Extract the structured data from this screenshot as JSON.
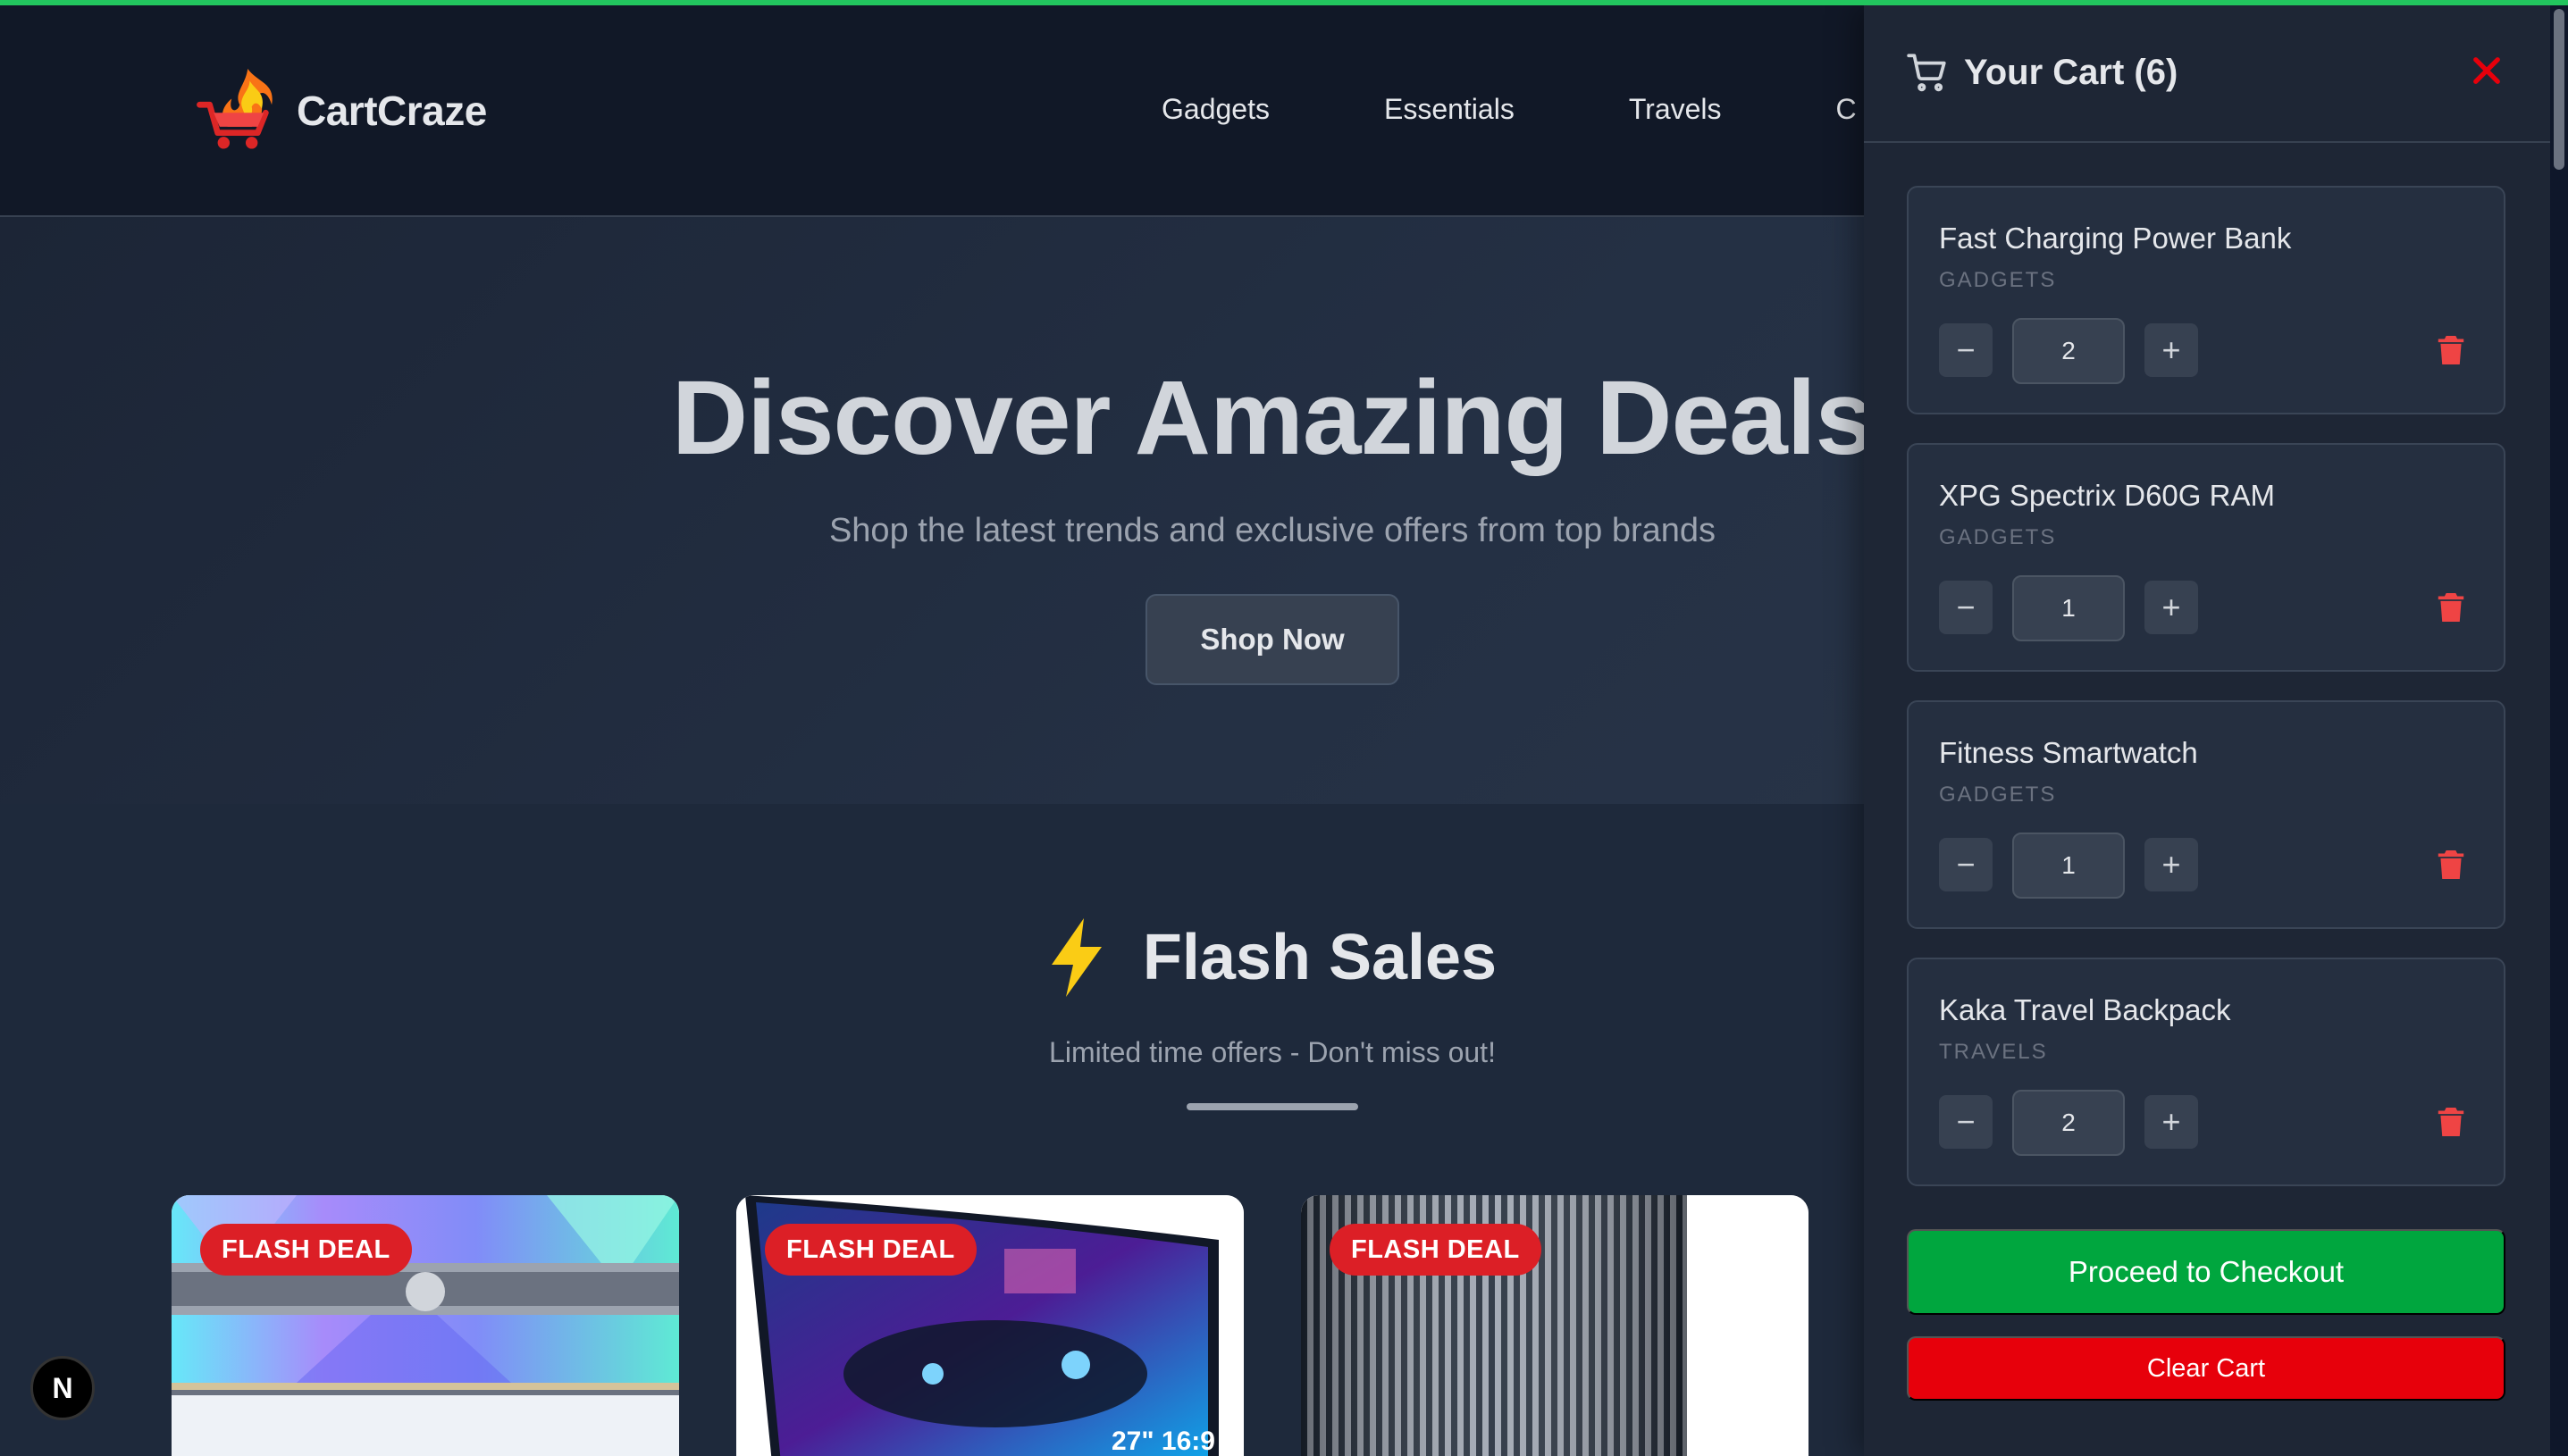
{
  "header": {
    "brand": "CartCraze",
    "nav": [
      "Gadgets",
      "Essentials",
      "Travels",
      "C"
    ]
  },
  "hero": {
    "title": "Discover Amazing Deals",
    "subtitle": "Shop the latest trends and exclusive offers from top brands",
    "cta": "Shop Now"
  },
  "flash": {
    "title": "Flash Sales",
    "subtitle": "Limited time offers - Don't miss out!",
    "badge": "FLASH DEAL",
    "monitor_label": "27\" 16:9"
  },
  "dev_badge": "N",
  "cart": {
    "title": "Your Cart (6)",
    "items": [
      {
        "name": "Fast Charging Power Bank",
        "category": "GADGETS",
        "qty": "2"
      },
      {
        "name": "XPG Spectrix D60G RAM",
        "category": "GADGETS",
        "qty": "1"
      },
      {
        "name": "Fitness Smartwatch",
        "category": "GADGETS",
        "qty": "1"
      },
      {
        "name": "Kaka Travel Backpack",
        "category": "TRAVELS",
        "qty": "2"
      }
    ],
    "minus_symbol": "−",
    "plus_symbol": "+",
    "checkout": "Proceed to Checkout",
    "clear": "Clear Cart"
  },
  "colors": {
    "accent_green": "#00a63e",
    "danger_red": "#e7000b",
    "badge_red": "#dc1f26",
    "bolt_yellow": "#facc15"
  },
  "icons": [
    "cart-icon",
    "close-icon",
    "trash-icon",
    "lightning-bolt-icon",
    "flame-cart-logo"
  ]
}
